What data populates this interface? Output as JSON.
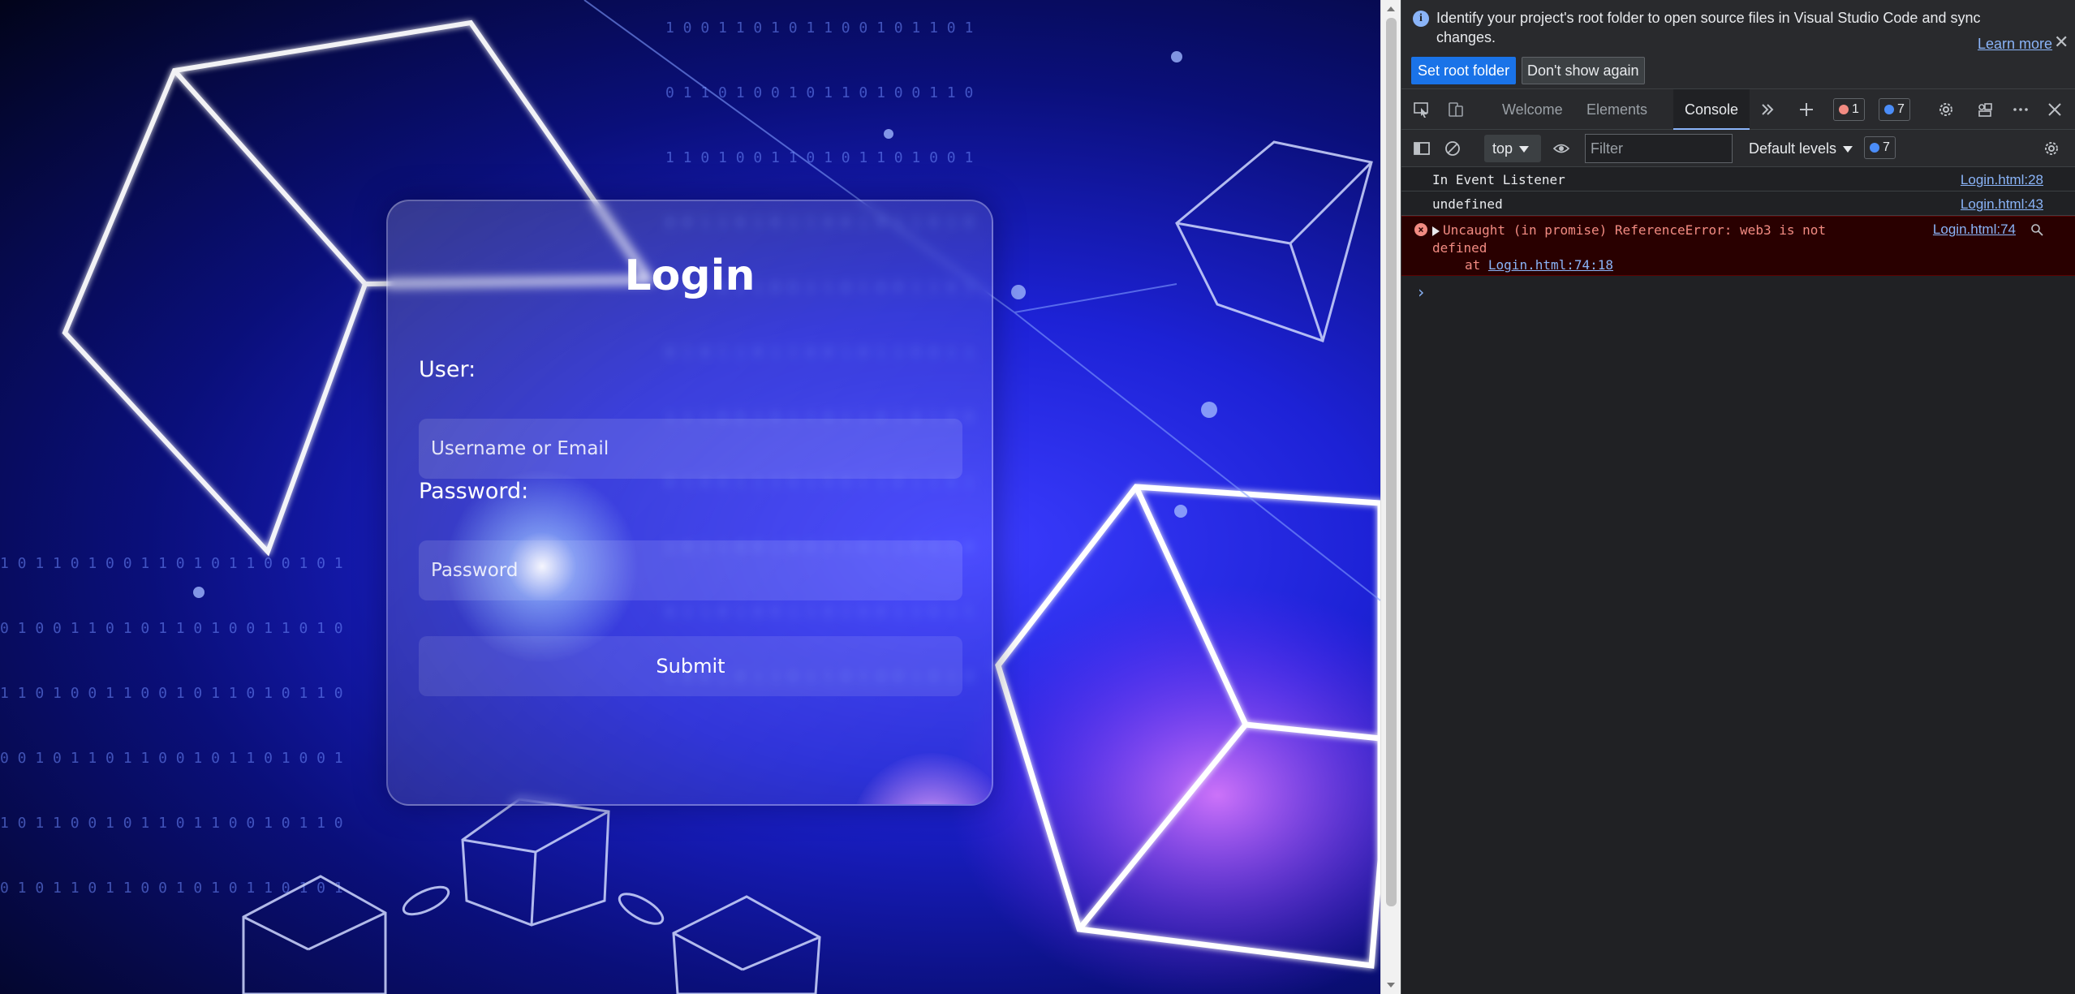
{
  "login": {
    "title": "Login",
    "user_label": "User:",
    "username_placeholder": "Username or Email",
    "password_label": "Password:",
    "password_placeholder": "Password",
    "submit_label": "Submit"
  },
  "devtools": {
    "infobar": {
      "message": "Identify your project's root folder to open source files in Visual Studio Code and sync changes.",
      "learn_more": "Learn more",
      "set_root_label": "Set root folder",
      "dont_show_label": "Don't show again"
    },
    "tabs": [
      {
        "label": "Welcome"
      },
      {
        "label": "Elements"
      },
      {
        "label": "Console"
      }
    ],
    "badges": {
      "errors": "1",
      "messages": "7"
    },
    "toolbar": {
      "context": "top",
      "filter_placeholder": "Filter",
      "levels": "Default levels",
      "issues": "7"
    },
    "console": {
      "rows": [
        {
          "message": "In Event Listener",
          "source": "Login.html:28"
        },
        {
          "message": "undefined",
          "source": "Login.html:43"
        }
      ],
      "error": {
        "message": "Uncaught (in promise) ReferenceError: web3 is not defined",
        "at_prefix": "at ",
        "at_link": "Login.html:74:18",
        "source": "Login.html:74"
      }
    },
    "colors": {
      "accent": "#8ab4f8",
      "error": "#f28b82",
      "primary_button": "#1a73e8"
    }
  }
}
